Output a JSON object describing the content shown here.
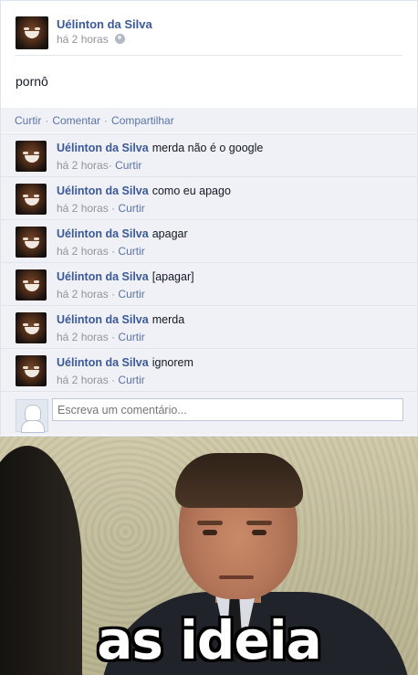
{
  "post": {
    "author": "Uélinton da Silva",
    "time": "há 2 horas",
    "privacy_icon": "globe-icon",
    "text": "pornô"
  },
  "actions": {
    "like": "Curtir",
    "comment": "Comentar",
    "share": "Compartilhar",
    "separator": "·"
  },
  "comments": [
    {
      "author": "Uélinton da Silva",
      "text": "merda não é o google",
      "time": "há 2 horas",
      "like": "Curtir"
    },
    {
      "author": "Uélinton da Silva",
      "text": "como eu apago",
      "time": "há 2 horas",
      "like": "Curtir"
    },
    {
      "author": "Uélinton da Silva",
      "text": "apagar",
      "time": "há 2 horas",
      "like": "Curtir"
    },
    {
      "author": "Uélinton da Silva",
      "text": "[apagar]",
      "time": "há 2 horas",
      "like": "Curtir"
    },
    {
      "author": "Uélinton da Silva",
      "text": "merda",
      "time": "há 2 horas",
      "like": "Curtir"
    },
    {
      "author": "Uélinton da Silva",
      "text": "ignorem",
      "time": "há 2 horas",
      "like": "Curtir"
    }
  ],
  "write_comment": {
    "placeholder": "Escreva um comentário..."
  },
  "meme": {
    "caption": "as ideia"
  }
}
